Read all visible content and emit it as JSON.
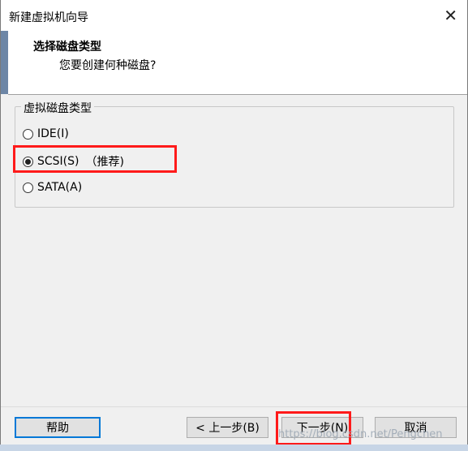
{
  "window": {
    "title": "新建虚拟机向导"
  },
  "header": {
    "title": "选择磁盘类型",
    "subtitle": "您要创建何种磁盘?"
  },
  "disk_group": {
    "legend": "虚拟磁盘类型",
    "options": [
      {
        "label": "IDE(I)",
        "checked": false
      },
      {
        "label": "SCSI(S)",
        "checked": true,
        "note": "（推荐)"
      },
      {
        "label": "SATA(A)",
        "checked": false
      }
    ]
  },
  "buttons": {
    "help": "帮助",
    "back": "< 上一步(B)",
    "next": "下一步(N)",
    "cancel": "取消"
  },
  "watermark": "https://blog.csdn.net/Pengchen"
}
